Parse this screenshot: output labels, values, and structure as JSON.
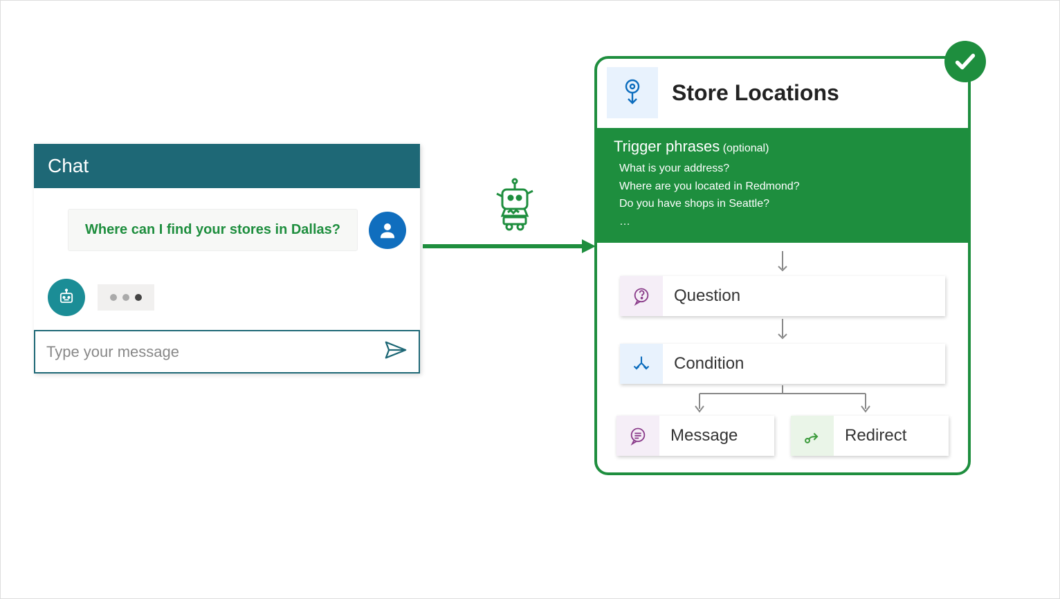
{
  "chat": {
    "header": "Chat",
    "user_message": "Where can I find your stores in Dallas?",
    "input_placeholder": "Type your message"
  },
  "topic": {
    "title": "Store Locations",
    "trigger_title": "Trigger phrases",
    "trigger_optional": "(optional)",
    "phrases": {
      "p1": "What is your address?",
      "p2": "Where are you located in Redmond?",
      "p3": "Do you have shops in Seattle?",
      "more": "…"
    },
    "nodes": {
      "question": "Question",
      "condition": "Condition",
      "message": "Message",
      "redirect": "Redirect"
    }
  }
}
